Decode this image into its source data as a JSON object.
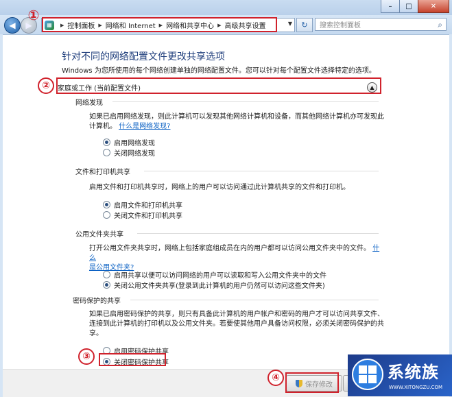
{
  "window": {
    "minimize": "–",
    "maximize": "□",
    "close": "✕"
  },
  "nav": {
    "breadcrumbs": [
      "控制面板",
      "网络和 Internet",
      "网络和共享中心",
      "高级共享设置"
    ],
    "search_placeholder": "搜索控制面板"
  },
  "page": {
    "title": "针对不同的网络配置文件更改共享选项",
    "subtitle": "Windows 为您所使用的每个网络创建单独的网络配置文件。您可以针对每个配置文件选择特定的选项。",
    "profile_header": "家庭或工作 (当前配置文件)"
  },
  "sections": {
    "discovery": {
      "title": "网络发现",
      "desc": "如果已启用网络发现，则此计算机可以发现其他网络计算机和设备，而其他网络计算机亦可发现此计算机。",
      "link": "什么是网络发现?",
      "options": [
        "启用网络发现",
        "关闭网络发现"
      ],
      "selected": 0
    },
    "printer": {
      "title": "文件和打印机共享",
      "desc": "启用文件和打印机共享时，网络上的用户可以访问通过此计算机共享的文件和打印机。",
      "options": [
        "启用文件和打印机共享",
        "关闭文件和打印机共享"
      ],
      "selected": 0
    },
    "public": {
      "title": "公用文件夹共享",
      "desc": "打开公用文件夹共享时，网络上包括家庭组成员在内的用户都可以访问公用文件夹中的文件。",
      "link_1": "什么",
      "link_2": "是公用文件夹?",
      "options": [
        "启用共享以便可以访问网络的用户可以读取和写入公用文件夹中的文件",
        "关闭公用文件夹共享(登录到此计算机的用户仍然可以访问这些文件夹)"
      ],
      "selected": 1
    },
    "password": {
      "title": "密码保护的共享",
      "desc_1": "如果已启用密码保护的共享，则只有具备此计算机的用户帐户和密码的用户才可以访问共享文件、",
      "desc_2": "连接到此计算机的打印机以及公用文件夹。若要使其他用户具备访问权限，必须关闭密码保护的共享。",
      "options": [
        "启用密码保护共享",
        "关闭密码保护共享"
      ],
      "selected": 1
    }
  },
  "footer": {
    "save_label": "保存修改"
  },
  "annotations": [
    "①",
    "②",
    "③",
    "④"
  ],
  "watermark": {
    "text": "系统族",
    "url": "WWW.XITONGZU.COM"
  }
}
